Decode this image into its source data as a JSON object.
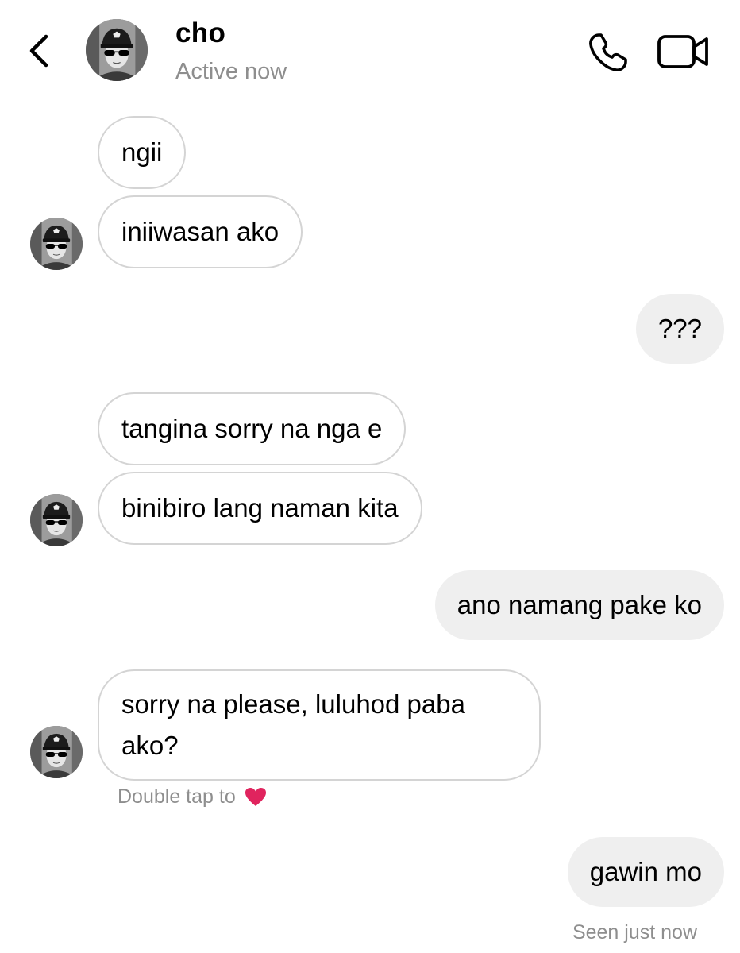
{
  "header": {
    "contact_name": "cho",
    "status": "Active now",
    "icons": [
      "chevron-left-icon",
      "phone-icon",
      "video-camera-icon"
    ]
  },
  "messages": [
    {
      "side": "in",
      "text": "ngii"
    },
    {
      "side": "in",
      "text": "iniiwasan ako"
    },
    {
      "side": "out",
      "text": "???"
    },
    {
      "side": "in",
      "text": "tangina sorry na nga e"
    },
    {
      "side": "in",
      "text": "binibiro lang naman kita"
    },
    {
      "side": "out",
      "text": "ano namang pake ko"
    },
    {
      "side": "in",
      "text": "sorry na please, luluhod paba ako?"
    },
    {
      "side": "out",
      "text": "gawin mo"
    }
  ],
  "double_tap_hint": "Double tap to",
  "seen_status": "Seen just now",
  "colors": {
    "incoming_border": "#d4d4d4",
    "outgoing_bg": "#efefef",
    "meta_text": "#8e8e8e",
    "heart": "#e0245e"
  }
}
